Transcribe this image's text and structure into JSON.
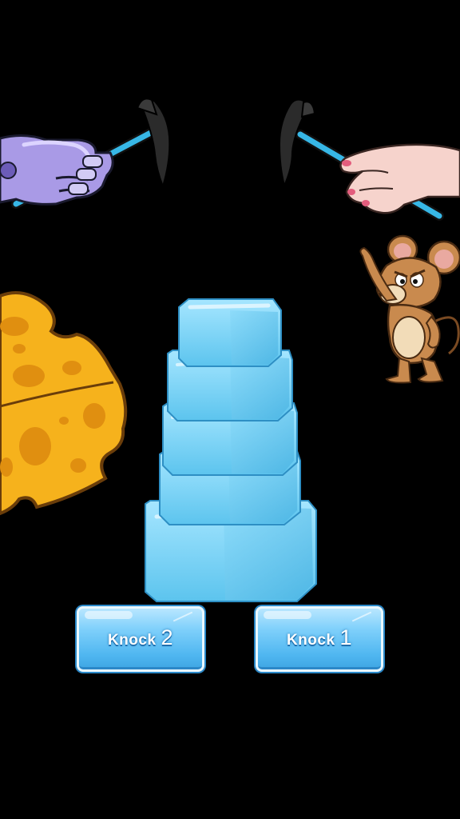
{
  "scene": {
    "background": "#000000",
    "characters": {
      "left_hand": "robot-hand",
      "right_hand": "human-hand",
      "mouse": "jerry-mouse",
      "cheese": "cheese-wedge"
    },
    "ice_tower": {
      "blocks": 5,
      "color": "#7fd3f7"
    }
  },
  "buttons": [
    {
      "text": "Knock",
      "number": "2"
    },
    {
      "text": "Knock",
      "number": "1"
    }
  ]
}
